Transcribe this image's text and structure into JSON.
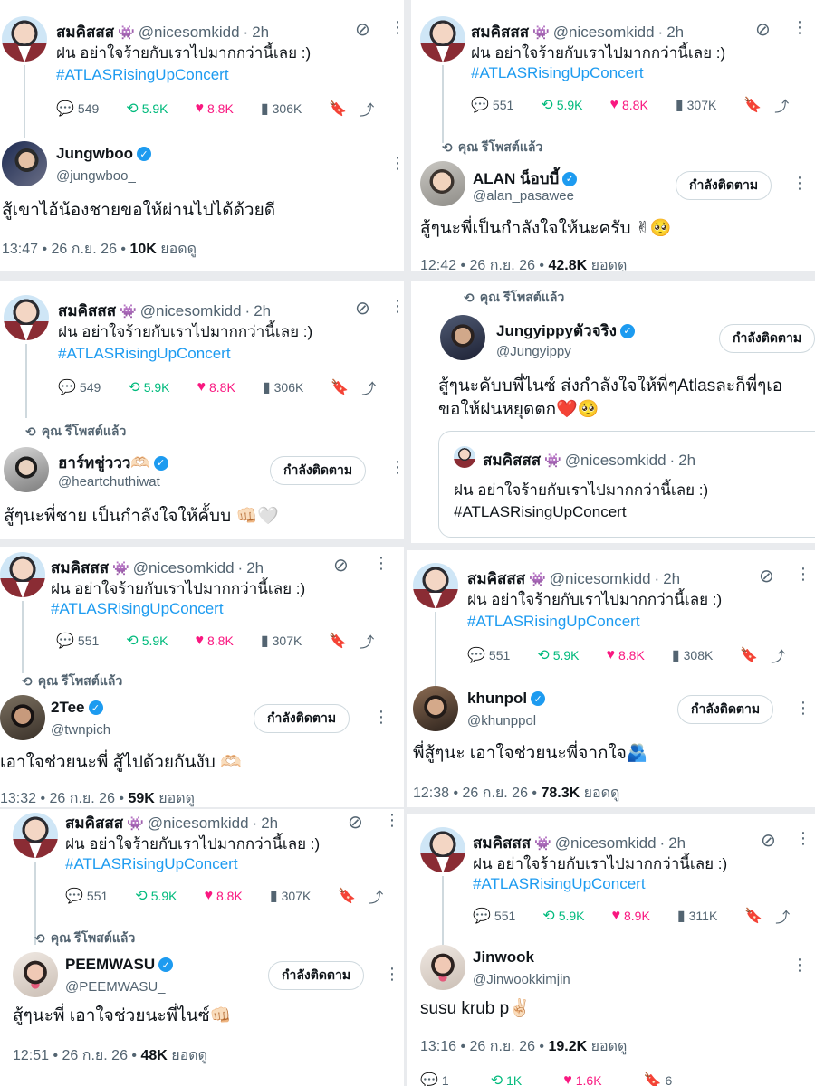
{
  "original": {
    "name": "สมคิสสส",
    "name_emoji": "👾",
    "handle": "@nicesomkidd",
    "time": "2h",
    "line1": "ฝน อย่าใจร้ายกับเราไปมากกว่านี้เลย :)",
    "hashtag": "#ATLASRisingUpConcert"
  },
  "labels": {
    "follow": "กำลังติดตาม",
    "reposted": "คุณ รีโพสต์แล้ว",
    "views_suffix": "ยอดดู",
    "dot": "•"
  },
  "cards": [
    {
      "stats": {
        "replies": "549",
        "reposts": "5.9K",
        "likes": "8.8K",
        "views": "306K"
      },
      "reply": {
        "name": "Jungwboo",
        "handle": "@jungwboo_",
        "text": "สู้เขาไอ้น้องชายขอให้ผ่านไปได้ด้วยดี",
        "time": "13:47 • 26 ก.ย. 26",
        "views": "10K"
      }
    },
    {
      "stats": {
        "replies": "551",
        "reposts": "5.9K",
        "likes": "8.8K",
        "views": "307K"
      },
      "reply": {
        "name": "ALAN น็อบบี้",
        "handle": "@alan_pasawee",
        "text": "สู้ๆนะพี่เป็นกำลังใจให้นะครับ ✌🥺",
        "time": "12:42 • 26 ก.ย. 26",
        "views": "42.8K"
      }
    },
    {
      "stats": {
        "replies": "549",
        "reposts": "5.9K",
        "likes": "8.8K",
        "views": "306K"
      },
      "reply": {
        "name": "ฮาร์ทชู่ววว🫶🏻",
        "handle": "@heartchuthiwat",
        "text": "สู้ๆนะพี่ชาย เป็นกำลังใจให้คั้บบ 👊🏻🤍"
      }
    },
    {
      "reply": {
        "name": "Jungyippyตัวจริง",
        "handle": "@Jungyippy",
        "text1": "สู้ๆนะคับบพี่ไนซ์ ส่งกำลังใจให้พี่ๆAtlasละก็พี่ๆเอ",
        "text2": "ขอให้ฝนหยุดตก❤️🥺"
      }
    },
    {
      "stats": {
        "replies": "551",
        "reposts": "5.9K",
        "likes": "8.8K",
        "views": "307K"
      },
      "reply": {
        "name": "2Tee",
        "handle": "@twnpich",
        "text": "เอาใจช่วยนะพี่ สู้ไปด้วยกันงับ 🫶🏻",
        "time": "13:32 • 26 ก.ย. 26",
        "views": "59K"
      }
    },
    {
      "stats": {
        "replies": "551",
        "reposts": "5.9K",
        "likes": "8.8K",
        "views": "308K"
      },
      "reply": {
        "name": "khunpol",
        "handle": "@khunppol",
        "text": "พี่สู้ๆนะ เอาใจช่วยนะพี่จากใจ🫂",
        "time": "12:38 • 26 ก.ย. 26",
        "views": "78.3K"
      }
    },
    {
      "stats": {
        "replies": "551",
        "reposts": "5.9K",
        "likes": "8.8K",
        "views": "307K"
      },
      "reply": {
        "name": "PEEMWASU",
        "handle": "@PEEMWASU_",
        "text": "สู้ๆนะพี่ เอาใจช่วยนะพี่ไนซ์👊🏻",
        "time": "12:51 • 26 ก.ย. 26",
        "views": "48K"
      }
    },
    {
      "stats": {
        "replies": "551",
        "reposts": "5.9K",
        "likes": "8.9K",
        "views": "311K"
      },
      "reply": {
        "name": "Jinwook",
        "handle": "@Jinwookkimjin",
        "text": "susu krub p✌🏻",
        "time": "13:16 • 26 ก.ย. 26",
        "views": "19.2K"
      }
    }
  ],
  "footer_stats": {
    "replies": "1",
    "reposts": "1K",
    "likes": "1.6K",
    "bookmarks": "6"
  }
}
